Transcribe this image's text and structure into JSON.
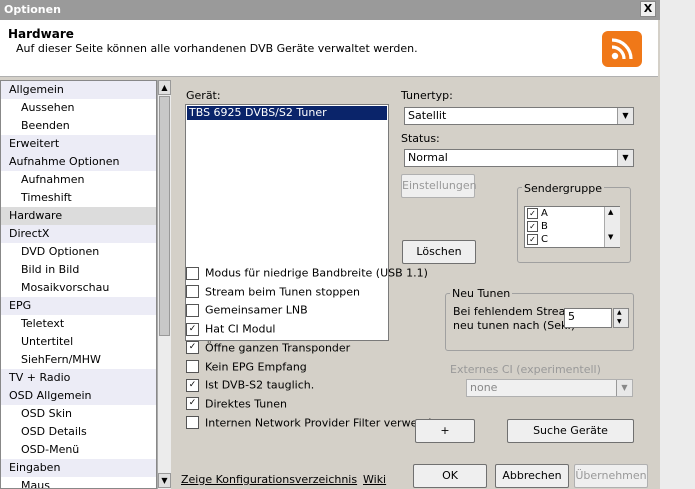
{
  "window": {
    "title": "Optionen",
    "close_glyph": "X"
  },
  "header": {
    "title": "Hardware",
    "subtitle": "Auf dieser Seite können alle vorhandenen DVB Geräte verwaltet werden.",
    "icon": "rss-icon",
    "icon_color": "#f07818"
  },
  "sidebar": {
    "items": [
      {
        "label": "Allgemein",
        "level": "cat"
      },
      {
        "label": "Aussehen",
        "level": "sub"
      },
      {
        "label": "Beenden",
        "level": "sub"
      },
      {
        "label": "Erweitert",
        "level": "cat"
      },
      {
        "label": "Aufnahme Optionen",
        "level": "cat"
      },
      {
        "label": "Aufnahmen",
        "level": "sub"
      },
      {
        "label": "Timeshift",
        "level": "sub"
      },
      {
        "label": "Hardware",
        "level": "cat",
        "selected": true
      },
      {
        "label": "DirectX",
        "level": "cat"
      },
      {
        "label": "DVD Optionen",
        "level": "sub"
      },
      {
        "label": "Bild in Bild",
        "level": "sub"
      },
      {
        "label": "Mosaikvorschau",
        "level": "sub"
      },
      {
        "label": "EPG",
        "level": "cat"
      },
      {
        "label": "Teletext",
        "level": "sub"
      },
      {
        "label": "Untertitel",
        "level": "sub"
      },
      {
        "label": "SiehFern/MHW",
        "level": "sub"
      },
      {
        "label": "TV + Radio",
        "level": "cat"
      },
      {
        "label": "OSD Allgemein",
        "level": "cat"
      },
      {
        "label": "OSD Skin",
        "level": "sub"
      },
      {
        "label": "OSD Details",
        "level": "sub"
      },
      {
        "label": "OSD-Menü",
        "level": "sub"
      },
      {
        "label": "Eingaben",
        "level": "cat"
      },
      {
        "label": "Maus",
        "level": "sub"
      }
    ]
  },
  "device": {
    "label": "Gerät:",
    "items": [
      "TBS 6925 DVBS/S2 Tuner"
    ],
    "selected": "TBS 6925 DVBS/S2 Tuner"
  },
  "tuner": {
    "type_label": "Tunertyp:",
    "type_value": "Satellit",
    "status_label": "Status:",
    "status_value": "Normal"
  },
  "buttons": {
    "settings": "Einstellungen",
    "delete": "Löschen",
    "plus": "+",
    "search": "Suche Geräte",
    "ok": "OK",
    "cancel": "Abbrechen",
    "apply": "Übernehmen"
  },
  "sendergruppe": {
    "label": "Sendergruppe",
    "items": [
      {
        "label": "A",
        "checked": true
      },
      {
        "label": "B",
        "checked": true
      },
      {
        "label": "C",
        "checked": true
      }
    ]
  },
  "options": [
    {
      "label": "Modus für niedrige Bandbreite (USB 1.1)",
      "checked": false
    },
    {
      "label": "Stream beim Tunen stoppen",
      "checked": false
    },
    {
      "label": "Gemeinsamer LNB",
      "checked": false
    },
    {
      "label": "Hat CI Modul",
      "checked": true
    },
    {
      "label": "Öffne ganzen Transponder",
      "checked": true
    },
    {
      "label": "Kein EPG Empfang",
      "checked": false
    },
    {
      "label": "Ist DVB-S2 tauglich.",
      "checked": true
    },
    {
      "label": "Direktes Tunen",
      "checked": true
    },
    {
      "label": "Internen Network Provider Filter verwenden",
      "checked": false
    }
  ],
  "neu_tunen": {
    "label": "Neu Tunen",
    "text_line1": "Bei fehlendem Stream",
    "text_line2": "neu tunen nach (Sek.)",
    "value": "5"
  },
  "externes_ci": {
    "label": "Externes CI (experimentell)",
    "value": "none"
  },
  "links": {
    "config": "Zeige Konfigurationsverzeichnis",
    "wiki": "Wiki"
  },
  "colors": {
    "selection": "#0a246a",
    "accent": "#f07818"
  }
}
